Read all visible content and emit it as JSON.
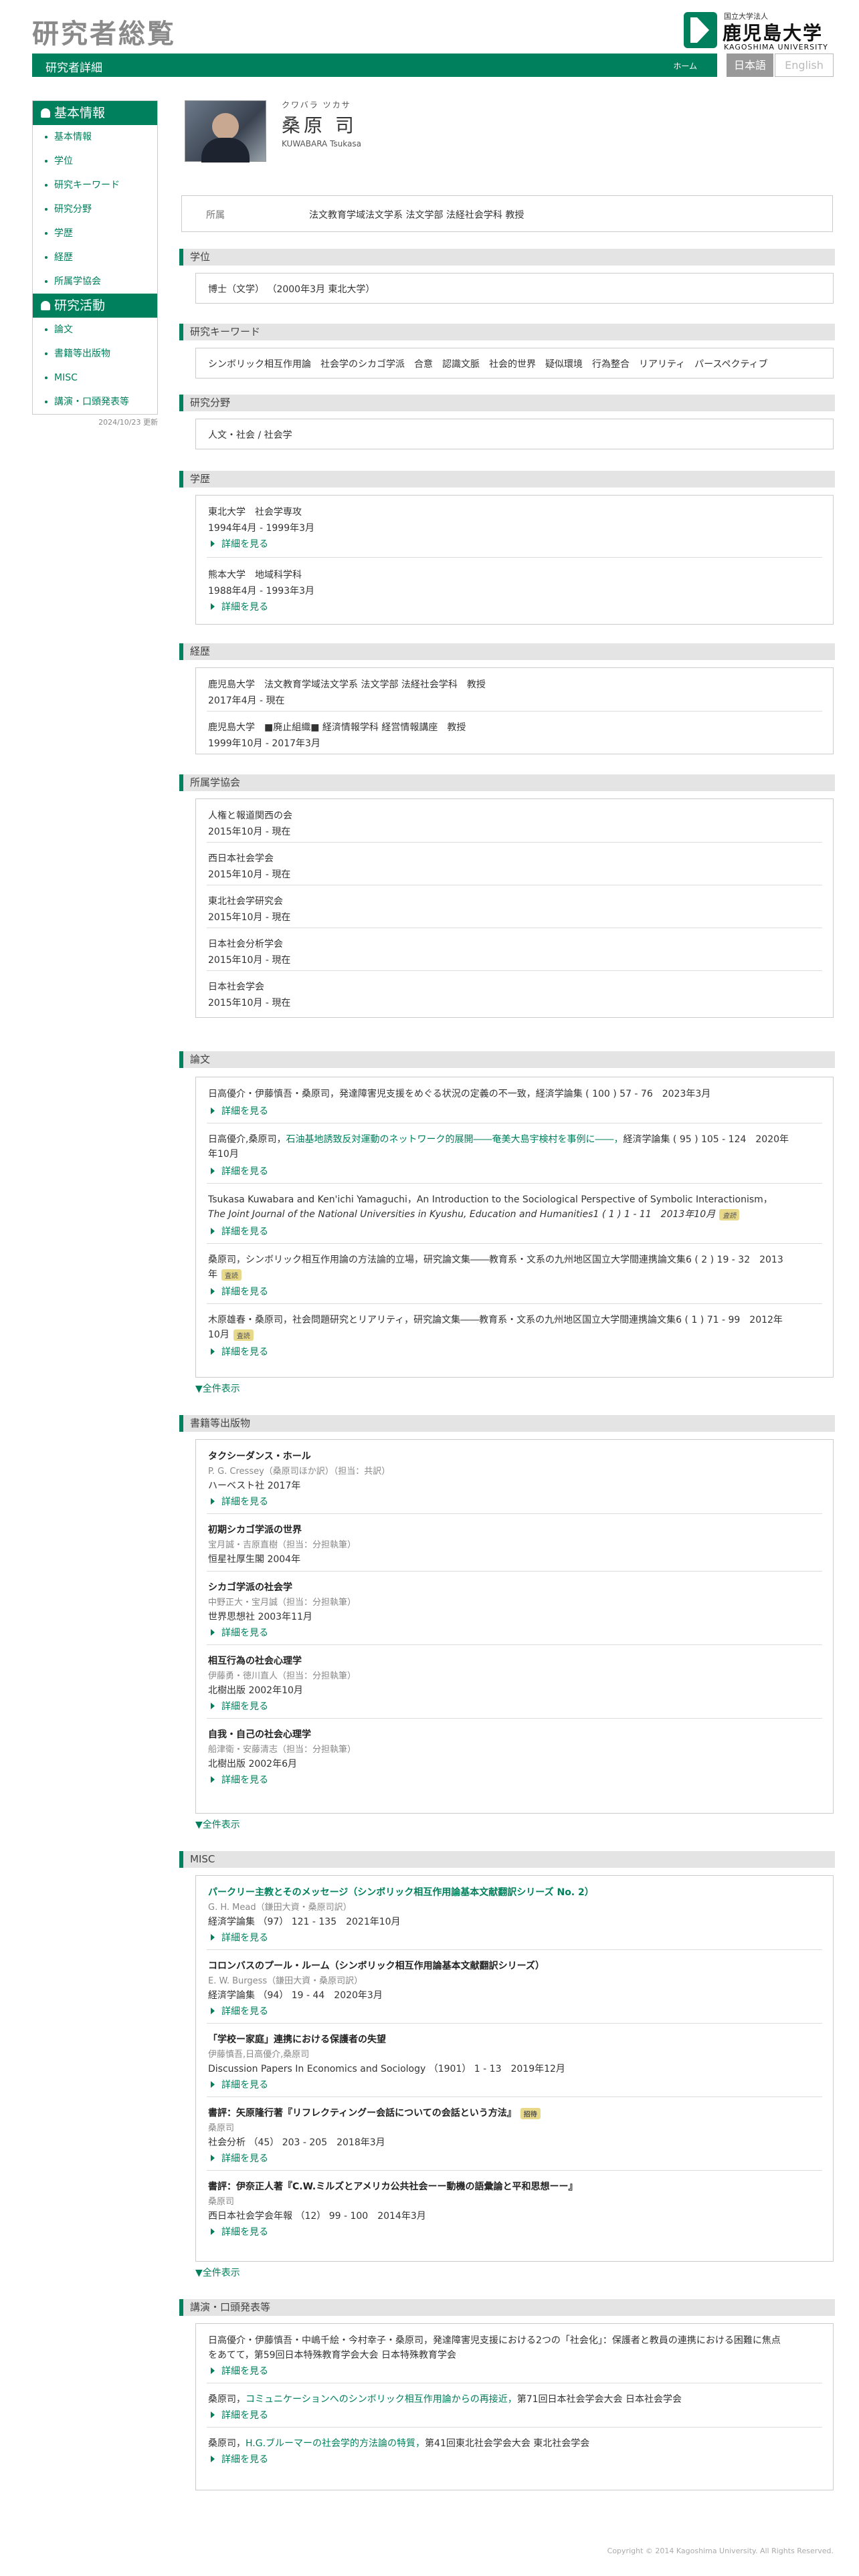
{
  "header": {
    "site_title": "研究者総覧",
    "logo_small": "国立大学法人",
    "logo_big": "鹿児島大学",
    "logo_en": "KAGOSHIMA UNIVERSITY",
    "page_title": "研究者詳細",
    "home": "ホーム",
    "lang_ja": "日本語",
    "lang_en": "English"
  },
  "sidebar": {
    "basic_head": "基本情報",
    "basic": [
      "基本情報",
      "学位",
      "研究キーワード",
      "研究分野",
      "学歴",
      "経歴",
      "所属学協会"
    ],
    "act_head": "研究活動",
    "act": [
      "論文",
      "書籍等出版物",
      "MISC",
      "講演・口頭発表等"
    ],
    "updated": "2024/10/23 更新"
  },
  "profile": {
    "kana": "クワバラ ツカサ",
    "name": "桑原 司",
    "romaji": "KUWABARA Tsukasa",
    "aff_label": "所属",
    "aff_value": "法文教育学域法文学系 法文学部 法経社会学科 教授"
  },
  "labels": {
    "degree": "学位",
    "keywords": "研究キーワード",
    "field": "研究分野",
    "education": "学歴",
    "career": "経歴",
    "society": "所属学協会",
    "papers": "論文",
    "books": "書籍等出版物",
    "misc": "MISC",
    "talks": "講演・口頭発表等",
    "more": "詳細を見る",
    "showall": "▼全件表示",
    "peer": "査読",
    "invited": "招待"
  },
  "degree": "博士（文学） （2000年3月 東北大学）",
  "keywords": "シンボリック相互作用論　社会学のシカゴ学派　合意　認識文脈　社会的世界　疑似環境　行為整合　リアリティ　パースペクティブ",
  "field": "人文・社会 / 社会学",
  "education": [
    {
      "school": "東北大学　社会学専攻",
      "period": "1994年4月 - 1999年3月"
    },
    {
      "school": "熊本大学　地域科学科",
      "period": "1988年4月 - 1993年3月"
    }
  ],
  "career": [
    {
      "title": "鹿児島大学　法文教育学域法文学系 法文学部 法経社会学科　教授",
      "period": "2017年4月 - 現在"
    },
    {
      "title": "鹿児島大学　■廃止組織■ 経済情報学科 経営情報講座　教授",
      "period": "1999年10月 - 2017年3月"
    }
  ],
  "society": [
    {
      "name": "人権と報道関西の会",
      "period": "2015年10月 - 現在"
    },
    {
      "name": "西日本社会学会",
      "period": "2015年10月 - 現在"
    },
    {
      "name": "東北社会学研究会",
      "period": "2015年10月 - 現在"
    },
    {
      "name": "日本社会分析学会",
      "period": "2015年10月 - 現在"
    },
    {
      "name": "日本社会学会",
      "period": "2015年10月 - 現在"
    }
  ],
  "papers": [
    {
      "pre": "日高優介・伊藤慎吾・桑原司，",
      "title": "発達障害児支援をめぐる状況の定義の不一致，",
      "post": "経済学論集 ( 100 ) 57 - 76　2023年3月",
      "line2": ""
    },
    {
      "pre": "日高優介,桑原司，",
      "title": "石油基地誘致反対運動のネットワーク的展開――奄美大島宇検村を事例に――，",
      "post": "経済学論集 ( 95 ) 105 - 124　2020年",
      "line2": "年10月"
    },
    {
      "pre": "Tsukasa Kuwabara and Ken'ichi Yamaguchi，",
      "title": "An Introduction to the Sociological Perspective of Symbolic Interactionism，",
      "post": "",
      "line2": "The Joint Journal of the National Universities in Kyushu, Education and Humanities1 ( 1 ) 1 - 11　2013年10月"
    },
    {
      "pre": "桑原司，",
      "title": "シンボリック相互作用論の方法論的立場，",
      "post": "研究論文集――教育系・文系の九州地区国立大学間連携論文集6 ( 2 ) 19 - 32　2013",
      "line2": "年"
    },
    {
      "pre": "木原雄春・桑原司，",
      "title": "社会問題研究とリアリティ，",
      "post": "研究論文集――教育系・文系の九州地区国立大学間連携論文集6 ( 1 ) 71 - 99　2012年",
      "line2": "10月"
    }
  ],
  "books": [
    {
      "title": "タクシーダンス・ホール",
      "authors": "P. G. Cressey（桑原司ほか訳）（担当：共訳）",
      "pub": "ハーベスト社 2017年"
    },
    {
      "title": "初期シカゴ学派の世界",
      "authors": "宝月誠・吉原直樹（担当：分担執筆）",
      "pub": "恒星社厚生閣 2004年"
    },
    {
      "title": "シカゴ学派の社会学",
      "authors": "中野正大・宝月誠（担当：分担執筆）",
      "pub": "世界思想社 2003年11月"
    },
    {
      "title": "相互行為の社会心理学",
      "authors": "伊藤勇・徳川直人（担当：分担執筆）",
      "pub": "北樹出版 2002年10月"
    },
    {
      "title": "自我・自己の社会心理学",
      "authors": "船津衛・安藤清志（担当：分担執筆）",
      "pub": "北樹出版 2002年6月"
    }
  ],
  "misc": [
    {
      "title": "パークリー主教とそのメッセージ（シンボリック相互作用論基本文献翻訳シリーズ No. 2）",
      "authors": "G. H. Mead（鎌田大資・桑原司訳）",
      "pub": "経済学論集 （97） 121 - 135　2021年10月"
    },
    {
      "title": "コロンバスのプール・ルーム（シンボリック相互作用論基本文献翻訳シリーズ）",
      "authors": "E. W. Burgess（鎌田大資・桑原司訳）",
      "pub": "経済学論集 （94） 19 - 44　2020年3月"
    },
    {
      "title": "「学校ー家庭」連携における保護者の失望",
      "authors": "伊藤慎吾,日高優介,桑原司",
      "pub": "Discussion Papers In Economics and Sociology （1901） 1 - 13　2019年12月"
    },
    {
      "title": "書評：矢原隆行著『リフレクティングー会話についての会話という方法』",
      "authors": "桑原司",
      "pub": "社会分析 （45） 203 - 205　2018年3月"
    },
    {
      "title": "書評：伊奈正人著『C.W.ミルズとアメリカ公共社会ーー動機の語彙論と平和思想ーー』",
      "authors": "桑原司",
      "pub": "西日本社会学会年報 （12） 99 - 100　2014年3月"
    }
  ],
  "talks": [
    {
      "l1": "日高優介・伊藤慎吾・中嶋千絵・今村幸子・桑原司，発達障害児支援における2つの「社会化」：保護者と教員の連携における困難に焦点",
      "l2": "をあてて，第59回日本特殊教育学会大会 日本特殊教育学会"
    },
    {
      "pre": "桑原司，",
      "title": "コミュニケーションへのシンボリック相互作用論からの再接近，",
      "post": "第71回日本社会学会大会 日本社会学会"
    },
    {
      "pre": "桑原司，",
      "title": "H.G.ブルーマーの社会学的方法論の特質，",
      "post": "第41回東北社会学会大会 東北社会学会"
    }
  ],
  "footer": "Copyright © 2014 Kagoshima University. All Rights Reserved."
}
